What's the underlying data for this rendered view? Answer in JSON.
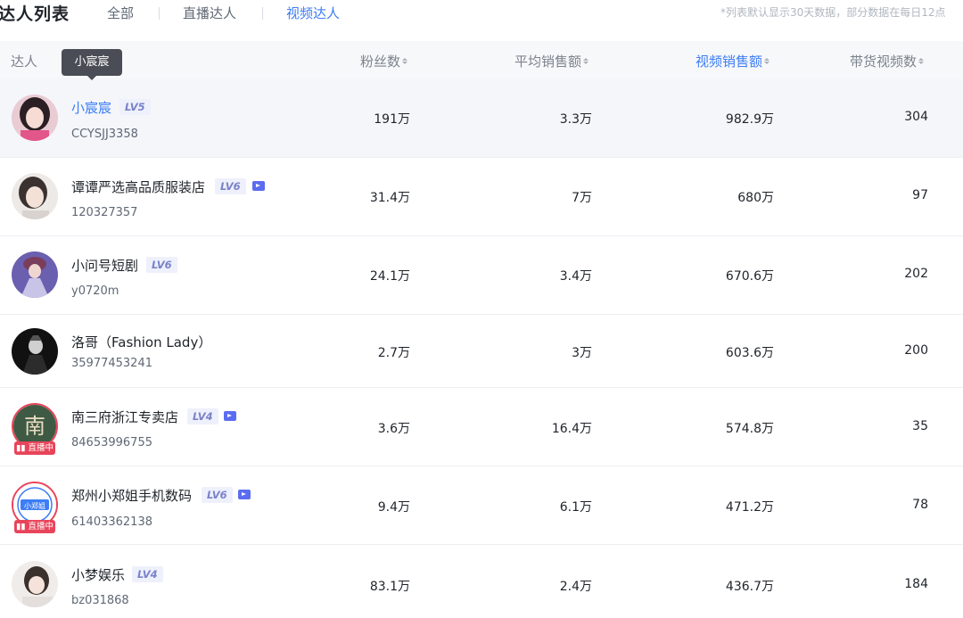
{
  "header": {
    "title": "达人列表",
    "tabs": [
      "全部",
      "直播达人",
      "视频达人"
    ],
    "active_tab": "视频达人",
    "notice": "*列表默认显示30天数据，部分数据在每日12点"
  },
  "table": {
    "columns": [
      "达人",
      "粉丝数",
      "平均销售额",
      "视频销售额",
      "带货视频数"
    ],
    "sorted_column": "视频销售额",
    "rows": [
      {
        "name": "小宸宸",
        "level": "LV5",
        "verified": false,
        "live": false,
        "id": "CCYSJJ3358",
        "fans": "191万",
        "avg_sales": "3.3万",
        "video_sales": "982.9万",
        "video_count": "304"
      },
      {
        "name": "谭谭严选高品质服装店",
        "level": "LV6",
        "verified": true,
        "live": false,
        "id": "120327357",
        "fans": "31.4万",
        "avg_sales": "7万",
        "video_sales": "680万",
        "video_count": "97"
      },
      {
        "name": "小问号短剧",
        "level": "LV6",
        "verified": false,
        "live": false,
        "id": "y0720m",
        "fans": "24.1万",
        "avg_sales": "3.4万",
        "video_sales": "670.6万",
        "video_count": "202"
      },
      {
        "name": "洛哥（Fashion Lady）",
        "level": "",
        "verified": false,
        "live": false,
        "id": "35977453241",
        "fans": "2.7万",
        "avg_sales": "3万",
        "video_sales": "603.6万",
        "video_count": "200"
      },
      {
        "name": "南三府浙江专卖店",
        "level": "LV4",
        "verified": true,
        "live": true,
        "id": "84653996755",
        "fans": "3.6万",
        "avg_sales": "16.4万",
        "video_sales": "574.8万",
        "video_count": "35"
      },
      {
        "name": "郑州小郑姐手机数码",
        "level": "LV6",
        "verified": true,
        "live": true,
        "id": "61403362138",
        "fans": "9.4万",
        "avg_sales": "6.1万",
        "video_sales": "471.2万",
        "video_count": "78"
      },
      {
        "name": "小梦娱乐",
        "level": "LV4",
        "verified": false,
        "live": false,
        "id": "bz031868",
        "fans": "83.1万",
        "avg_sales": "2.4万",
        "video_sales": "436.7万",
        "video_count": "184"
      }
    ]
  },
  "live_badge_label": "直播中",
  "avatar_text": {
    "row4": "南",
    "row5": "小郑姐"
  },
  "tooltip": "小宸宸",
  "colors": {
    "accent": "#3d7df5",
    "live": "#e8445a",
    "level_bg": "#eef0fb",
    "level_text": "#7a82c9",
    "hover_row": "#f4f6fa"
  }
}
